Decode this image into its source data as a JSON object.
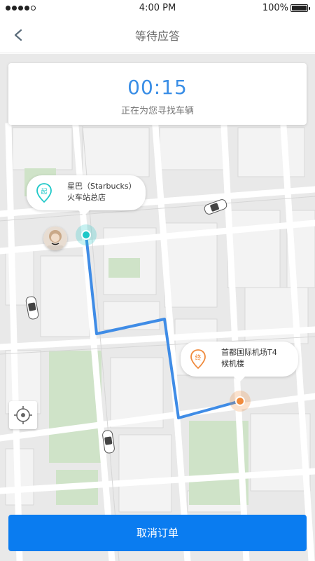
{
  "status_bar": {
    "time": "4:00 PM",
    "battery": "100%",
    "signal_icon": "signal-dots-icon",
    "battery_icon": "battery-icon"
  },
  "nav": {
    "title": "等待应答",
    "back_icon": "chevron-left-icon"
  },
  "timer": {
    "value": "00:15",
    "subtitle": "正在为您寻找车辆"
  },
  "start_point": {
    "badge": "起",
    "line1": "星巴（Starbucks）",
    "line2": "火车站总店"
  },
  "end_point": {
    "badge": "终",
    "line1": "首都国际机场T4",
    "line2": "候机楼"
  },
  "actions": {
    "cancel_label": "取消订单"
  },
  "colors": {
    "accent": "#3a8ee6",
    "button": "#0a7cf0",
    "start": "#1ec8c8",
    "end": "#f08a3c",
    "route": "#3f8ce6"
  },
  "icons": {
    "locate": "crosshair-icon",
    "car": "car-icon",
    "start_pin": "start-pin-icon",
    "end_pin": "end-pin-icon"
  }
}
